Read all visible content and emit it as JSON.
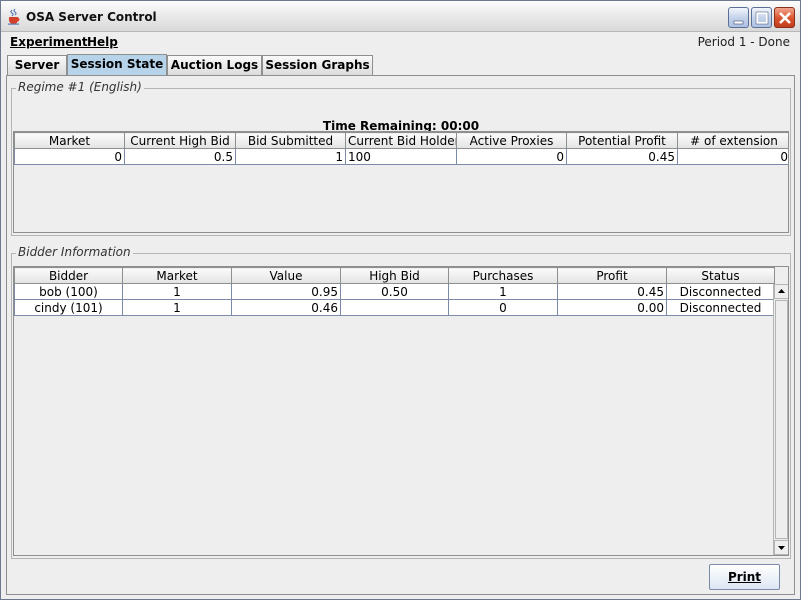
{
  "window": {
    "title": "OSA Server Control"
  },
  "menu": {
    "experiment": "Experiment",
    "help": "Help"
  },
  "status": "Period 1 - Done",
  "tabs": [
    {
      "label": "Server",
      "active": false
    },
    {
      "label": "Session State",
      "active": true
    },
    {
      "label": "Auction Logs",
      "active": false
    },
    {
      "label": "Session Graphs",
      "active": false
    }
  ],
  "regime": {
    "title": "Regime #1 (English)",
    "time_remaining": "Time Remaining: 00:00",
    "columns": [
      "Market",
      "Current High Bid",
      "Bid Submitted",
      "Current Bid Holder",
      "Active Proxies",
      "Potential Profit",
      "# of extension"
    ],
    "rows": [
      [
        "0",
        "0.5",
        "1",
        "100",
        "0",
        "0.45",
        "0"
      ]
    ]
  },
  "bidders": {
    "title": "Bidder Information",
    "columns": [
      "Bidder",
      "Market",
      "Value",
      "High Bid",
      "Purchases",
      "Profit",
      "Status"
    ],
    "rows": [
      [
        "bob (100)",
        "1",
        "0.95",
        "0.50",
        "1",
        "0.45",
        "Disconnected"
      ],
      [
        "cindy (101)",
        "1",
        "0.46",
        "",
        "0",
        "0.00",
        "Disconnected"
      ]
    ]
  },
  "buttons": {
    "print": "Print"
  },
  "icons": {
    "app": "java-cup-icon",
    "minimize": "minimize-icon",
    "maximize": "maximize-icon",
    "close": "close-icon"
  }
}
